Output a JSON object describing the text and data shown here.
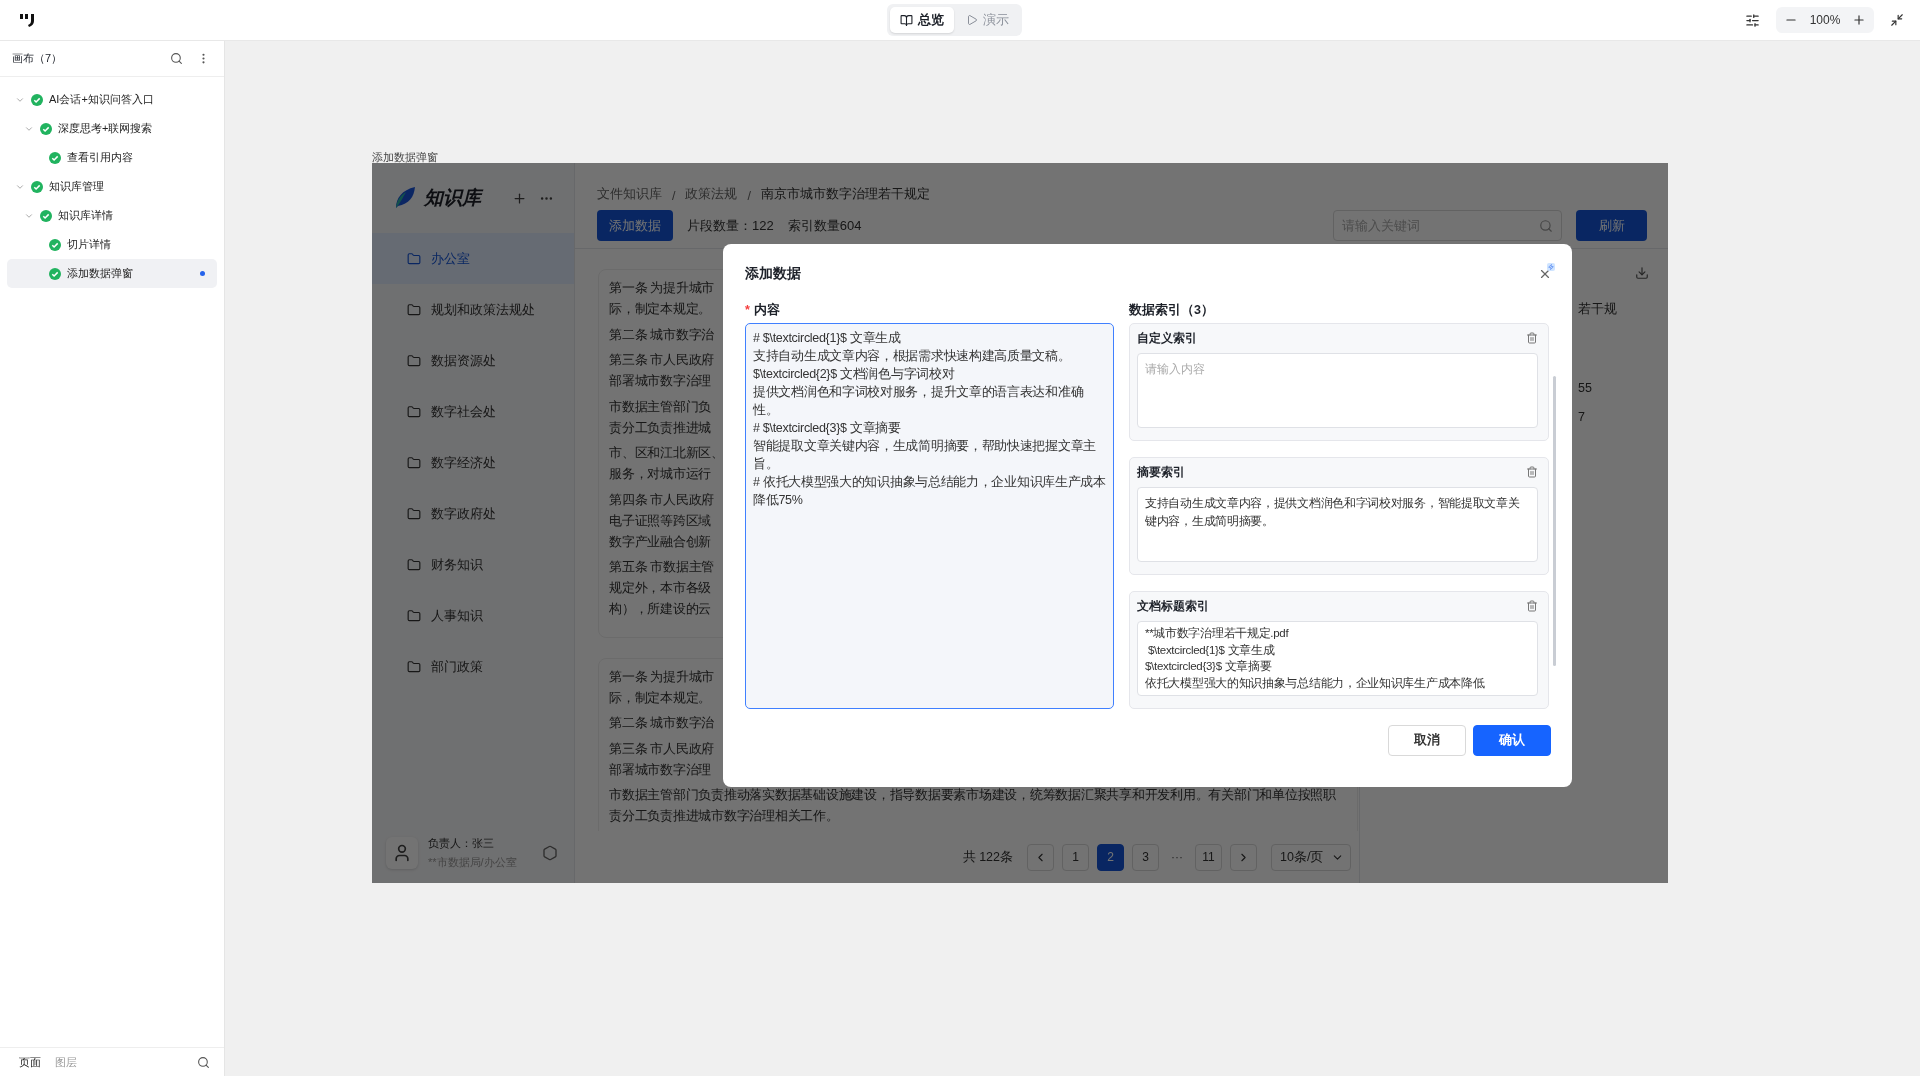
{
  "topbar": {
    "tabs": [
      {
        "label": "总览",
        "kind": "overview",
        "selected": true
      },
      {
        "label": "演示",
        "kind": "present",
        "selected": false
      }
    ],
    "zoom": "100%"
  },
  "left_panel": {
    "title": "画布（7）",
    "tree": [
      {
        "label": "AI会话+知识问答入口",
        "expanded": true,
        "selected": false,
        "children": [
          {
            "label": "深度思考+联网搜索",
            "expanded": true,
            "selected": false,
            "children": [
              {
                "label": "查看引用内容",
                "selected": false
              }
            ]
          }
        ]
      },
      {
        "label": "知识库管理",
        "expanded": true,
        "selected": false,
        "children": [
          {
            "label": "知识库详情",
            "expanded": true,
            "selected": false,
            "children": [
              {
                "label": "切片详情",
                "selected": false
              },
              {
                "label": "添加数据弹窗",
                "selected": true
              }
            ]
          }
        ]
      }
    ],
    "bottom_tabs": [
      {
        "label": "页面",
        "selected": true
      },
      {
        "label": "图层",
        "selected": false
      }
    ]
  },
  "frame": {
    "label": "添加数据弹窗",
    "app": {
      "brand": "知识库",
      "nav": [
        {
          "label": "办公室",
          "selected": true
        },
        {
          "label": "规划和政策法规处",
          "selected": false
        },
        {
          "label": "数据资源处",
          "selected": false
        },
        {
          "label": "数字社会处",
          "selected": false
        },
        {
          "label": "数字经济处",
          "selected": false
        },
        {
          "label": "数字政府处",
          "selected": false
        },
        {
          "label": "财务知识",
          "selected": false
        },
        {
          "label": "人事知识",
          "selected": false
        },
        {
          "label": "部门政策",
          "selected": false
        }
      ],
      "owner": {
        "name": "负责人：张三",
        "org": "**市数据局/办公室"
      },
      "breadcrumb": [
        "文件知识库",
        "政策法规",
        "南京市城市数字治理若干规定"
      ],
      "breadcrumb_separator": "/",
      "add_button": "添加数据",
      "segment_count": "片段数量：122",
      "index_count": "索引数量604",
      "search": {
        "placeholder": "请输入关键词"
      },
      "refresh_button": "刷新",
      "cards": [
        {
          "paragraphs": [
            [
              "第一条 为提升城市",
              "际，制定本规定。"
            ],
            [
              "第二条 城市数字治"
            ],
            [
              "第三条 市人民政府",
              "部署城市数字治理"
            ],
            [
              "市数据主管部门负",
              "责分工负责推进城"
            ],
            [
              "市、区和江北新区、",
              "服务，对城市运行"
            ],
            [
              "第四条 市人民政府",
              "电子证照等跨区域",
              "数字产业融合创新"
            ],
            [
              "第五条 市数据主管",
              "规定外，本市各级",
              "构），所建设的云"
            ]
          ]
        },
        {
          "paragraphs": [
            [
              "第一条 为提升城市",
              "际，制定本规定。"
            ],
            [
              "第二条 城市数字治"
            ],
            [
              "第三条 市人民政府",
              "部署城市数字治理"
            ],
            [
              "市数据主管部门负责推动落实数据基础设施建设，指导数据要素市场建设，统筹数据汇聚共享和开发利用。有关部门和单位按照职",
              "责分工负责推进城市数字治理相关工作。"
            ]
          ]
        }
      ],
      "side_fragments": [
        "若干规",
        "55",
        "7"
      ],
      "pagination": {
        "total": "共 122条",
        "pages": [
          {
            "label": "1",
            "kind": "page",
            "selected": false
          },
          {
            "label": "2",
            "kind": "page",
            "selected": true
          },
          {
            "label": "3",
            "kind": "page",
            "selected": false
          },
          {
            "label": "···",
            "kind": "ellipsis"
          },
          {
            "label": "11",
            "kind": "page",
            "selected": false
          }
        ],
        "page_size": "10条/页"
      }
    },
    "modal": {
      "title": "添加数据",
      "content_label": "内容",
      "required_mark": "*",
      "content_lines": [
        "# $\\textcircled{1}$ 文章生成",
        "支持自动生成文章内容，根据需求快速构建高质量文稿。",
        "$\\textcircled{2}$ 文档润色与字词校对",
        "提供文档润色和字词校对服务，提升文章的语言表达和准确性。",
        "# $\\textcircled{3}$ 文章摘要",
        "智能提取文章关键内容，生成简明摘要，帮助快速把握文章主旨。",
        "# 依托大模型强大的知识抽象与总结能力，企业知识库生产成本降低75%"
      ],
      "index_title": "数据索引（3）",
      "index_items": [
        {
          "title": "自定义索引",
          "placeholder": "请输入内容"
        },
        {
          "title": "摘要索引",
          "lines": [
            "支持自动生成文章内容，提供文档润色和字词校对服务，智能提取文章关键内容，生成简明摘要。"
          ]
        },
        {
          "title": "文档标题索引",
          "lines": [
            "**城市数字治理若干规定.pdf",
            " $\\textcircled{1}$ 文章生成",
            "$\\textcircled{3}$ 文章摘要",
            "依托大模型强大的知识抽象与总结能力，企业知识库生产成本降低"
          ]
        }
      ],
      "buttons": [
        {
          "label": "取消",
          "kind": "secondary"
        },
        {
          "label": "确认",
          "kind": "primary"
        }
      ]
    }
  }
}
